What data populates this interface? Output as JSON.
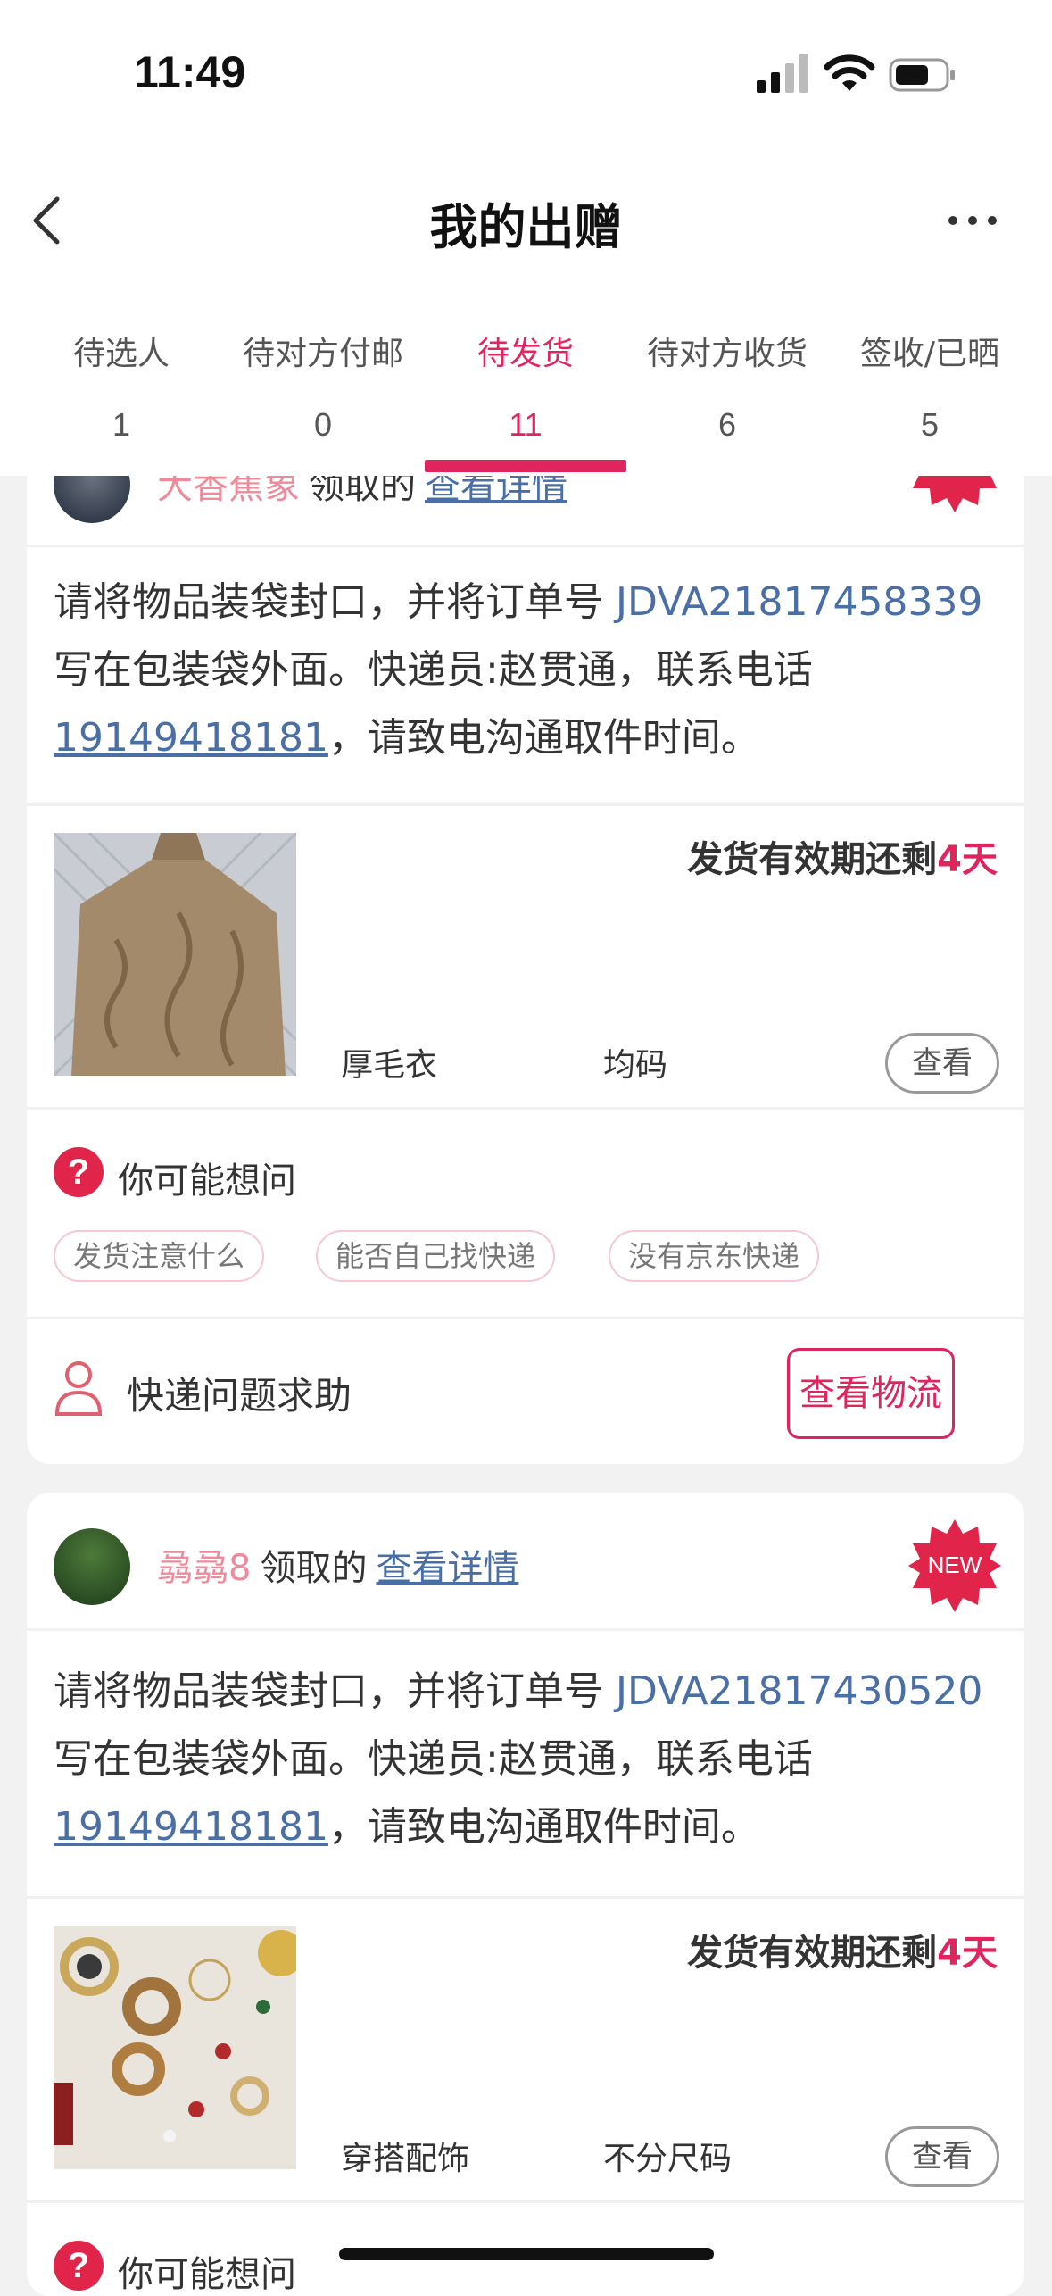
{
  "status": {
    "time": "11:49"
  },
  "nav": {
    "title": "我的出赠"
  },
  "tabs": [
    {
      "label": "待选人",
      "count": "1"
    },
    {
      "label": "待对方付邮",
      "count": "0"
    },
    {
      "label": "待发货",
      "count": "11"
    },
    {
      "label": "待对方收货",
      "count": "6"
    },
    {
      "label": "签收/已晒",
      "count": "5"
    }
  ],
  "cards": [
    {
      "user": "大香蕉象",
      "claimed": "领取的",
      "detail_link": "查看详情",
      "instr_pre": "请将物品装袋封口，并将订单号 ",
      "order_no": "JDVA21817458339",
      "instr_mid": " 写在包装袋外面。快递员:赵贯通，联系电话",
      "phone": "19149418181",
      "instr_post": "，请致电沟通取件时间。",
      "deadline_pre": "发货有效期还剩",
      "deadline_days": "4天",
      "item_name": "厚毛衣",
      "item_size": "均码",
      "view": "查看",
      "faq_title": "你可能想问",
      "chips": [
        "发货注意什么",
        "能否自己找快递",
        "没有京东快递"
      ],
      "help": "快递问题求助",
      "track": "查看物流"
    },
    {
      "user": "骉骉8",
      "claimed": "领取的",
      "detail_link": "查看详情",
      "badge": "NEW",
      "instr_pre": "请将物品装袋封口，并将订单号 ",
      "order_no": "JDVA21817430520",
      "instr_mid": " 写在包装袋外面。快递员:赵贯通，联系电话",
      "phone": "19149418181",
      "instr_post": "，请致电沟通取件时间。",
      "deadline_pre": "发货有效期还剩",
      "deadline_days": "4天",
      "item_name": "穿搭配饰",
      "item_size": "不分尺码",
      "view": "查看",
      "faq_title": "你可能想问"
    }
  ],
  "colors": {
    "accent": "#e0245e",
    "link": "#4a6fa5"
  }
}
